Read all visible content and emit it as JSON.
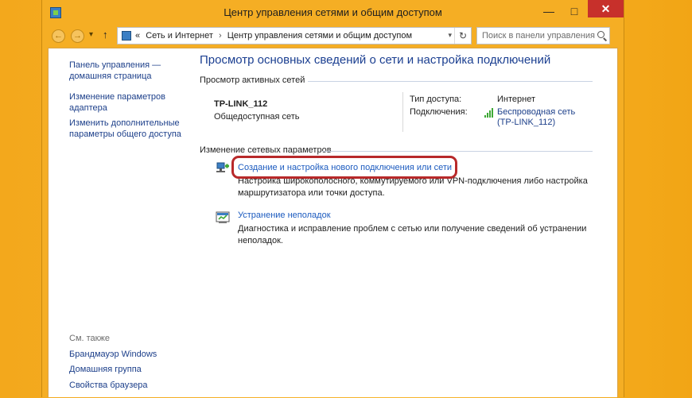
{
  "window": {
    "title": "Центр управления сетями и общим доступом",
    "minimize": "—",
    "maximize": "□",
    "close": "✕"
  },
  "nav": {
    "back": "←",
    "forward": "→",
    "recent": "▾",
    "up": "↑",
    "breadcrumb_prefix": "«",
    "breadcrumb": [
      "Сеть и Интернет",
      "Центр управления сетями и общим доступом"
    ],
    "breadcrumb_sep": "›",
    "dropdown": "▾",
    "refresh": "↻",
    "search_placeholder": "Поиск в панели управления"
  },
  "sidebar": {
    "links": [
      {
        "label": "Панель управления —\nдомашняя страница"
      },
      {
        "label": "Изменение параметров\nадаптера"
      },
      {
        "label": "Изменить дополнительные\nпараметры общего доступа"
      }
    ],
    "see_also_title": "См. также",
    "see_also": [
      {
        "label": "Брандмауэр Windows"
      },
      {
        "label": "Домашняя группа"
      },
      {
        "label": "Свойства браузера"
      }
    ]
  },
  "main": {
    "title": "Просмотр основных сведений о сети и настройка подключений",
    "active_networks_header": "Просмотр активных сетей",
    "network": {
      "name": "TP-LINK_112",
      "type": "Общедоступная сеть",
      "access_type_label": "Тип доступа:",
      "access_type_value": "Интернет",
      "connections_label": "Подключения:",
      "connection_link": "Беспроводная сеть\n(TP-LINK_112)"
    },
    "change_settings_header": "Изменение сетевых параметров",
    "tasks": [
      {
        "link": "Создание и настройка нового подключения или сети",
        "description": "Настройка широкополосного, коммутируемого или VPN-подключения либо настройка маршрутизатора или точки доступа."
      },
      {
        "link": "Устранение неполадок",
        "description": "Диагностика и исправление проблем с сетью или получение сведений об устранении неполадок."
      }
    ]
  },
  "colors": {
    "desktop": "#f5ae24",
    "link": "#1c3f8a",
    "title_blue": "#1b3f91",
    "close_red": "#c7302b",
    "highlight_red": "#b8292a"
  }
}
